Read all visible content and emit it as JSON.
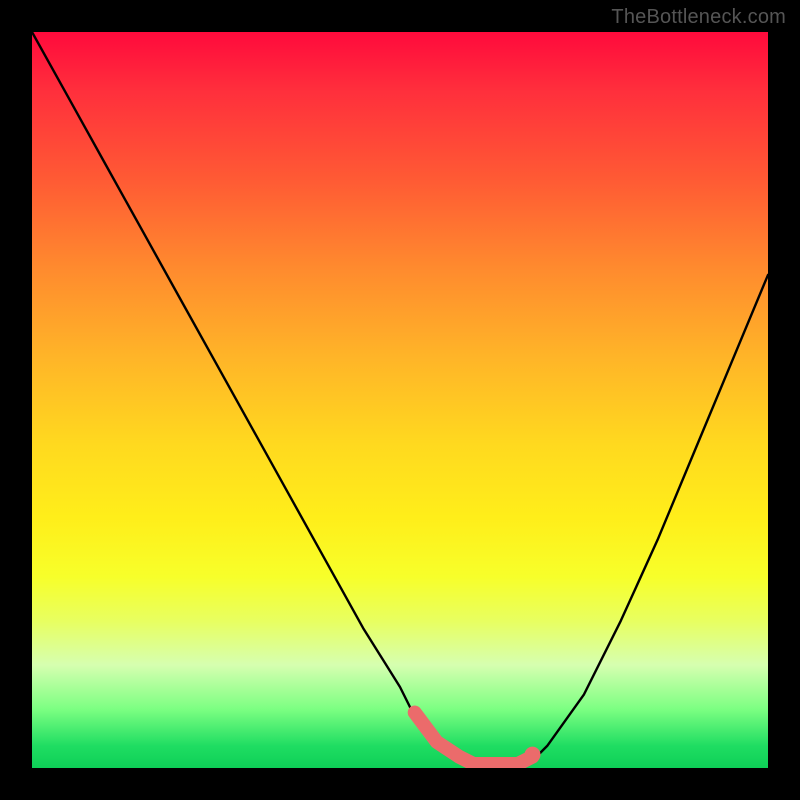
{
  "watermark": "TheBottleneck.com",
  "chart_data": {
    "type": "line",
    "title": "",
    "xlabel": "",
    "ylabel": "",
    "xlim": [
      0,
      100
    ],
    "ylim": [
      0,
      100
    ],
    "x": [
      0,
      5,
      10,
      15,
      20,
      25,
      30,
      35,
      40,
      45,
      50,
      52,
      55,
      58,
      60,
      62,
      64,
      66,
      68,
      70,
      75,
      80,
      85,
      90,
      95,
      100
    ],
    "values": [
      100,
      91,
      82,
      73,
      64,
      55,
      46,
      37,
      28,
      19,
      11,
      7,
      3,
      1,
      0,
      0,
      0,
      0,
      1,
      3,
      10,
      20,
      31,
      43,
      55,
      67
    ],
    "flat_region_x": [
      52,
      68
    ],
    "notes": "V-shaped bottleneck curve with flattened minimum around x≈52–68; left arm steeper and taller than right arm; pink marker segment overlaid on the flat valley; background heat gradient from red (worst) at top to green (best) at bottom."
  },
  "colors": {
    "curve": "#000000",
    "marker": "#eb6b6b",
    "frame": "#000000"
  }
}
